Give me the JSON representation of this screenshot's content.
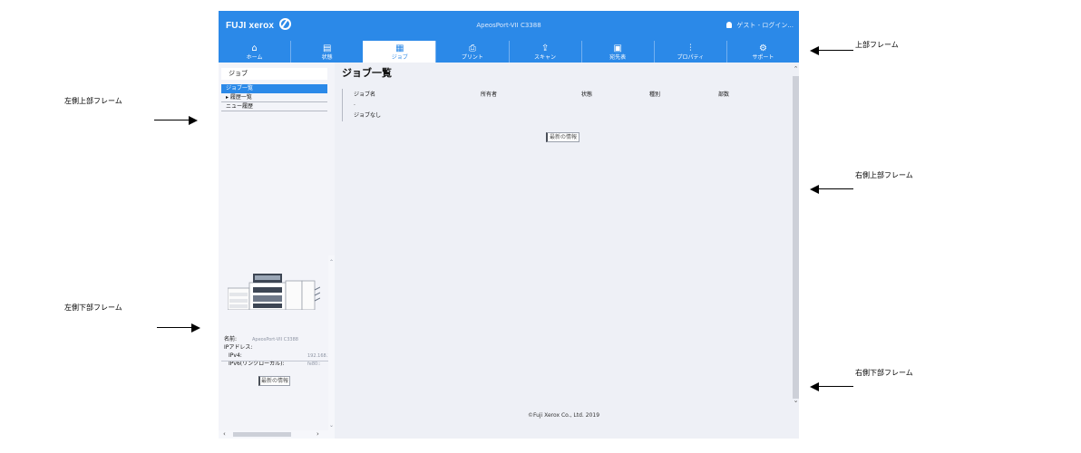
{
  "annotations": {
    "top_frame": "上部フレーム",
    "left_top_frame": "左側上部フレーム",
    "left_bottom_frame": "左側下部フレーム",
    "right_top_frame": "右側上部フレーム",
    "right_bottom_frame": "右側下部フレーム"
  },
  "header": {
    "logo": "FUJI xerox",
    "device_name": "ApeosPort-VII C3388",
    "user": "ゲスト - ログイン..."
  },
  "nav": {
    "tabs": [
      {
        "label": "ホーム",
        "icon": "home-icon",
        "glyph": "⌂"
      },
      {
        "label": "状態",
        "icon": "status-icon",
        "glyph": "▤"
      },
      {
        "label": "ジョブ",
        "icon": "job-icon",
        "glyph": "▦"
      },
      {
        "label": "プリント",
        "icon": "print-icon",
        "glyph": "⎙"
      },
      {
        "label": "スキャン",
        "icon": "scan-icon",
        "glyph": "⇪"
      },
      {
        "label": "宛先表",
        "icon": "address-book-icon",
        "glyph": "▣"
      },
      {
        "label": "プロパティ",
        "icon": "properties-icon",
        "glyph": "⫶"
      },
      {
        "label": "サポート",
        "icon": "support-icon",
        "glyph": "⚙"
      }
    ],
    "active_index": 2
  },
  "left_top": {
    "heading": "ジョブ",
    "items": [
      "ジョブ一覧",
      "▸ 履歴一覧",
      "ニュー履歴"
    ]
  },
  "left_bottom": {
    "name_label": "名前:",
    "name_value": "ApeosPort-VII C3388",
    "ip_label": "IPアドレス:",
    "ipv4_label": "IPv4:",
    "ipv4_value": "192.168.1",
    "ipv6_label": "IPv6(リンクローカル):",
    "ipv6_value": "fe80::",
    "refresh_button": "最新の情報"
  },
  "right_top": {
    "title": "ジョブ一覧",
    "columns": [
      "ジョブ名",
      "所有者",
      "状態",
      "種別",
      "部数"
    ],
    "dot": "·",
    "empty_text": "ジョブなし",
    "refresh_button": "最新の情報"
  },
  "right_bottom": {
    "copyright": "©Fuji Xerox Co., Ltd. 2019"
  },
  "colors": {
    "brand_blue": "#2b89e8",
    "frame_bg": "#eef0f6",
    "panel_bg": "#f3f4f9"
  }
}
